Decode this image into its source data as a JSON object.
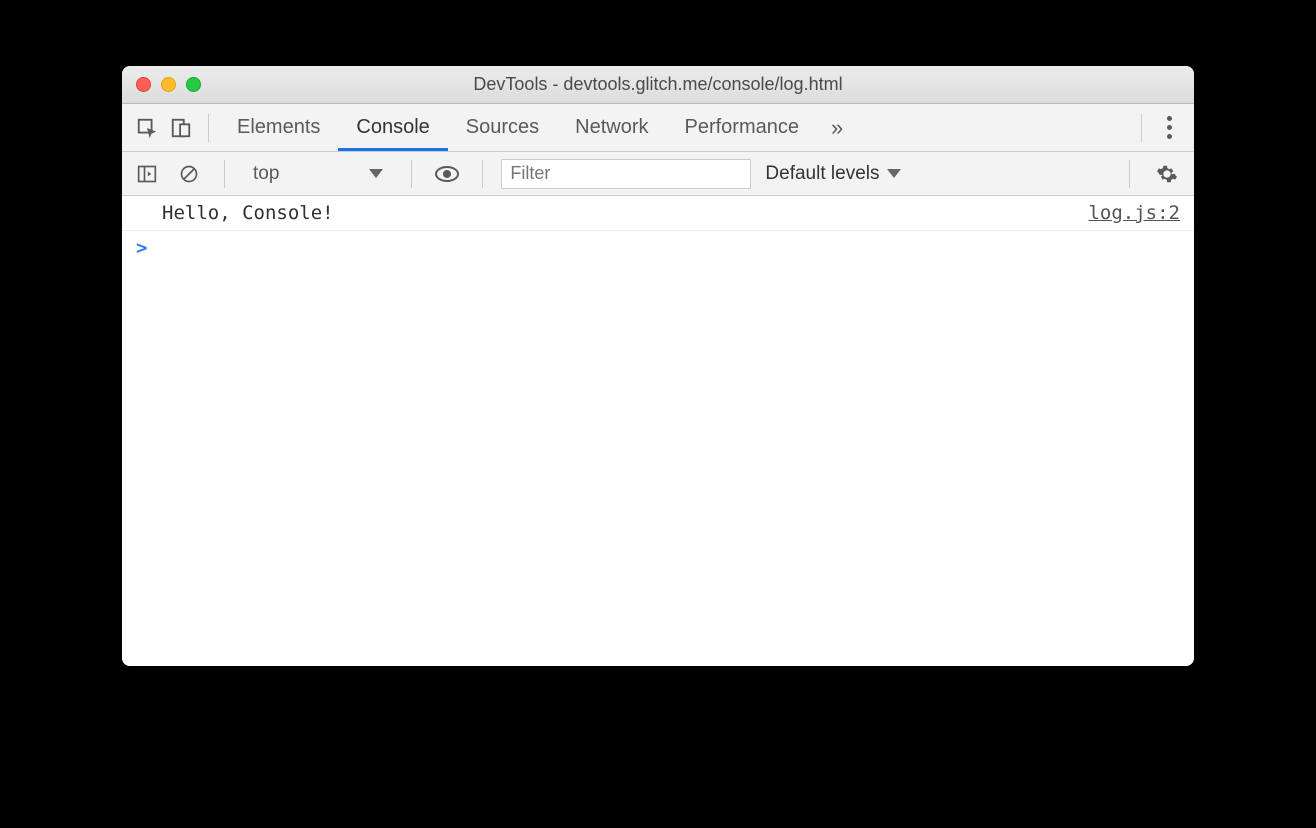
{
  "window": {
    "title": "DevTools - devtools.glitch.me/console/log.html"
  },
  "tabs": {
    "items": [
      "Elements",
      "Console",
      "Sources",
      "Network",
      "Performance"
    ],
    "active": "Console",
    "more_glyph": "»"
  },
  "toolbar": {
    "context": "top",
    "filter_placeholder": "Filter",
    "levels_label": "Default levels"
  },
  "log": {
    "rows": [
      {
        "message": "Hello, Console!",
        "source": "log.js:2"
      }
    ],
    "prompt": ">"
  }
}
